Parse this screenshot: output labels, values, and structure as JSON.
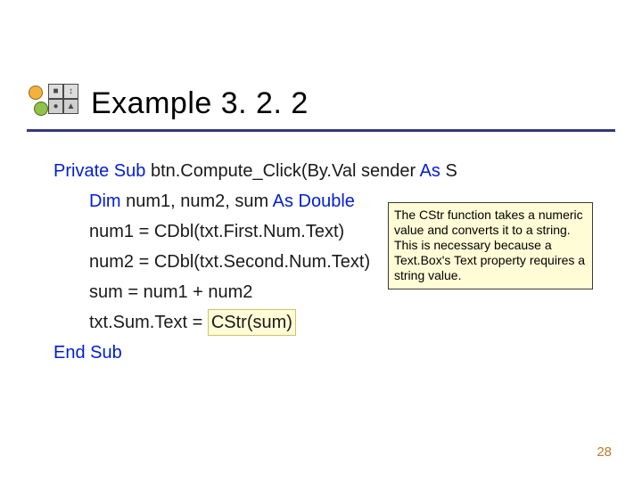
{
  "title": "Example 3. 2. 2",
  "code": {
    "line1_kw1": "Private Sub",
    "line1_rest": " btn.Compute_Click(By.Val  sender ",
    "line1_kw2": "As",
    "line1_trail": " S",
    "line2_kw1": "Dim",
    "line2_mid": " num1, num2, sum ",
    "line2_kw2": "As Double",
    "line3": "num1 = CDbl(txt.First.Num.Text)",
    "line4": "num2 = CDbl(txt.Second.Num.Text)",
    "line5": "sum = num1 + num2",
    "line6_pre": "txt.Sum.Text = ",
    "line6_hl": "CStr(sum)",
    "line7_kw": "End Sub"
  },
  "callout": "The CStr function takes a numeric value and converts it to a string. This is necessary because a Text.Box's Text property requires a string value.",
  "page_number": "28"
}
